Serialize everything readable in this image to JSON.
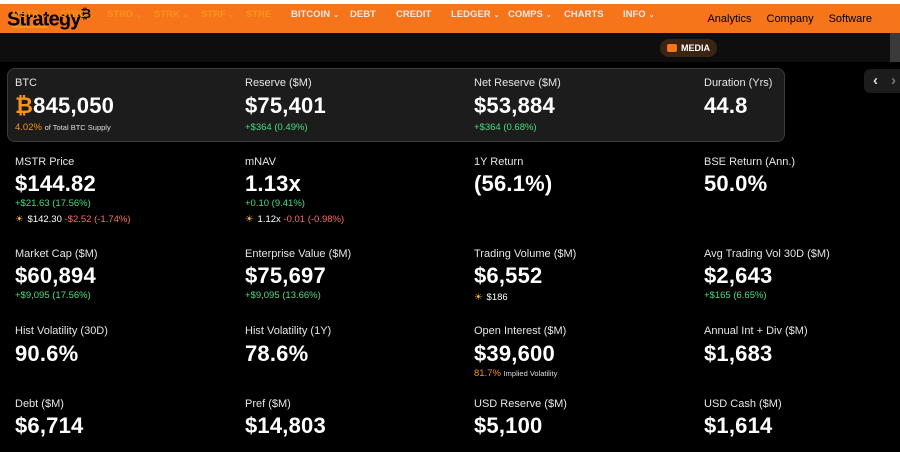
{
  "brand": {
    "name": "Strategy",
    "symbol": "₿"
  },
  "top_links": [
    "Analytics",
    "Company",
    "Software"
  ],
  "nav": [
    {
      "label": "MSTR",
      "has_chevron": true
    },
    {
      "label": "STRC",
      "has_chevron": true
    },
    {
      "label": "STRD",
      "has_chevron": true
    },
    {
      "label": "STRK",
      "has_chevron": true
    },
    {
      "label": "STRF",
      "has_chevron": true
    },
    {
      "label": "STRE",
      "has_chevron": false
    },
    {
      "label": "BITCOIN",
      "has_chevron": true
    },
    {
      "label": "DEBT",
      "has_chevron": false
    },
    {
      "label": "CREDIT",
      "has_chevron": false
    },
    {
      "label": "LEDGER",
      "has_chevron": true
    },
    {
      "label": "COMPS",
      "has_chevron": true
    },
    {
      "label": "CHARTS",
      "has_chevron": false
    },
    {
      "label": "INFO",
      "has_chevron": true
    },
    {
      "label": "MEDIA",
      "has_chevron": false
    }
  ],
  "nav_active": "MSTR",
  "arrows": {
    "prev": "‹",
    "next": "›"
  },
  "btc_panel": {
    "btc": {
      "label": "BTC",
      "symbol": "₿",
      "value": "845,050",
      "pct": "4.02%",
      "pct_label": "of Total BTC Supply"
    },
    "reserve": {
      "label": "Reserve ($M)",
      "value": "$75,401",
      "change": "+$364 (0.49%)"
    },
    "net_reserve": {
      "label": "Net Reserve ($M)",
      "value": "$53,884",
      "change": "+$364 (0.68%)"
    },
    "duration": {
      "label": "Duration (Yrs)",
      "value": "44.8"
    }
  },
  "metrics": {
    "mstr_price": {
      "label": "MSTR Price",
      "value": "$144.82",
      "change": "+$21.63 (17.56%)",
      "after_value": "$142.30",
      "after_change": "-$2.52 (-1.74%)"
    },
    "mnav": {
      "label": "mNAV",
      "value": "1.13x",
      "change": "+0.10 (9.41%)",
      "after_value": "1.12x",
      "after_change": "-0.01 (-0.98%)"
    },
    "one_y_return": {
      "label": "1Y Return",
      "value": "(56.1%)"
    },
    "bse_return": {
      "label": "BSE Return (Ann.)",
      "value": "50.0%"
    },
    "market_cap": {
      "label": "Market Cap ($M)",
      "value": "$60,894",
      "change": "+$9,095 (17.56%)"
    },
    "enterprise_value": {
      "label": "Enterprise Value ($M)",
      "value": "$75,697",
      "change": "+$9,095 (13.66%)"
    },
    "trading_volume": {
      "label": "Trading Volume ($M)",
      "value": "$6,552",
      "after_value": "$186"
    },
    "avg_trading_vol": {
      "label": "Avg Trading Vol 30D ($M)",
      "value": "$2,643",
      "change": "+$165 (6.65%)"
    },
    "hist_vol_30d": {
      "label": "Hist Volatility (30D)",
      "value": "90.6%"
    },
    "hist_vol_1y": {
      "label": "Hist Volatility (1Y)",
      "value": "78.6%"
    },
    "open_interest": {
      "label": "Open Interest ($M)",
      "value": "$39,600",
      "implied_vol": "81.7%",
      "implied_vol_label": "Implied Volatility"
    },
    "annual_int_div": {
      "label": "Annual Int + Div ($M)",
      "value": "$1,683"
    },
    "debt": {
      "label": "Debt ($M)",
      "value": "$6,714"
    },
    "pref": {
      "label": "Pref ($M)",
      "value": "$14,803"
    },
    "usd_reserve": {
      "label": "USD Reserve ($M)",
      "value": "$5,100"
    },
    "usd_cash": {
      "label": "USD Cash ($M)",
      "value": "$1,614"
    }
  },
  "icons": {
    "after_hours": "sun-icon",
    "media": "video-icon"
  },
  "colors": {
    "brand_orange": "#f7751a",
    "bitcoin_orange": "#f7931a",
    "positive": "#4ade80",
    "negative": "#ff6b6b"
  }
}
